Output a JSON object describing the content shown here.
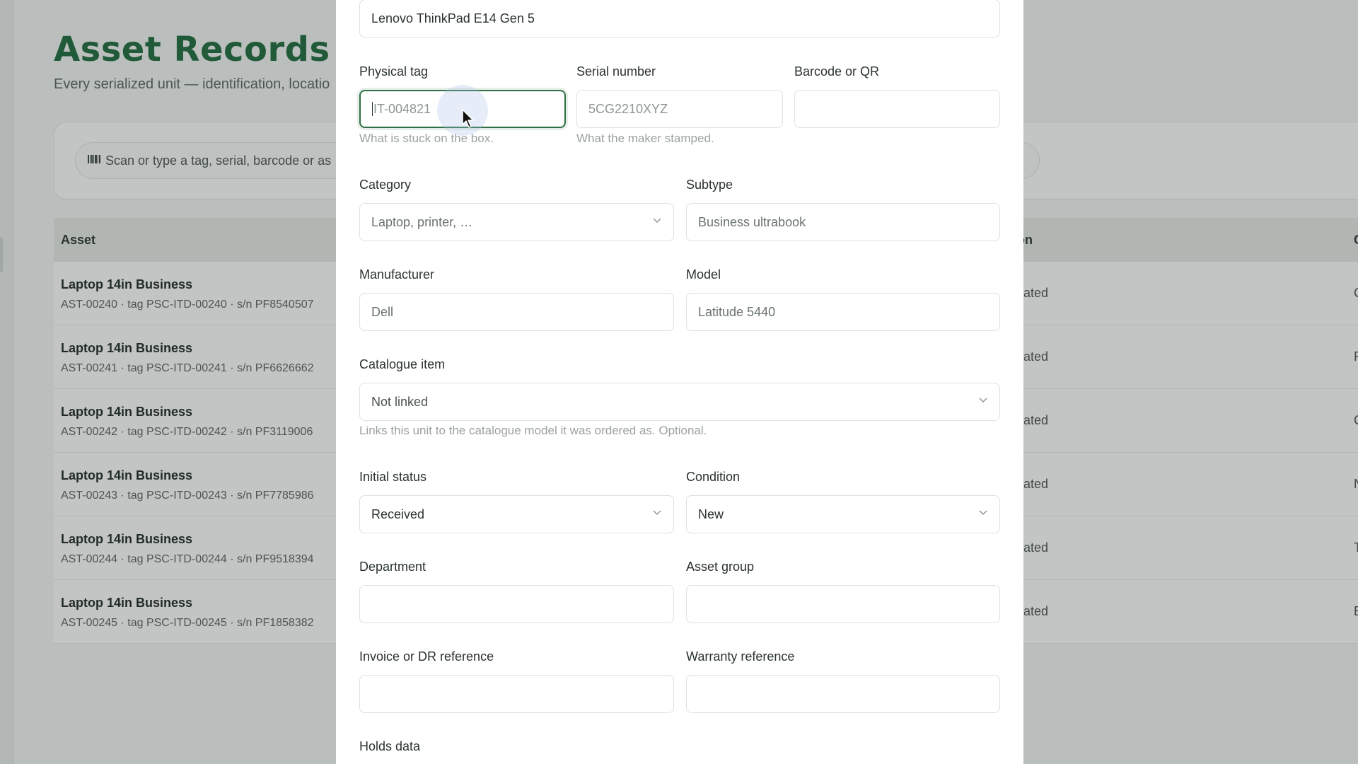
{
  "page": {
    "title": "Asset Records",
    "subtitle": "Every serialized unit — identification, locatio",
    "search_placeholder": "Scan or type a tag, serial, barcode or as",
    "search_icon": "barcode-icon",
    "columns": {
      "asset": "Asset",
      "location": "on",
      "condition": "C"
    },
    "rows": [
      {
        "name": "Laptop 14in Business",
        "meta": "AST-00240 · tag PSC-ITD-00240 · s/n PF8540507",
        "location": "cated",
        "condition": "C"
      },
      {
        "name": "Laptop 14in Business",
        "meta": "AST-00241 · tag PSC-ITD-00241 · s/n PF6626662",
        "location": "cated",
        "condition": "F"
      },
      {
        "name": "Laptop 14in Business",
        "meta": "AST-00242 · tag PSC-ITD-00242 · s/n PF3119006",
        "location": "cated",
        "condition": "C"
      },
      {
        "name": "Laptop 14in Business",
        "meta": "AST-00243 · tag PSC-ITD-00243 · s/n PF7785986",
        "location": "cated",
        "condition": "N"
      },
      {
        "name": "Laptop 14in Business",
        "meta": "AST-00244 · tag PSC-ITD-00244 · s/n PF9518394",
        "location": "cated",
        "condition": "T"
      },
      {
        "name": "Laptop 14in Business",
        "meta": "AST-00245 · tag PSC-ITD-00245 · s/n PF1858382",
        "location": "cated",
        "condition": "E"
      }
    ]
  },
  "modal": {
    "name_value": "Lenovo ThinkPad E14 Gen 5",
    "physical_tag": {
      "label": "Physical tag",
      "placeholder": "IT-004821",
      "help": "What is stuck on the box."
    },
    "serial_number": {
      "label": "Serial number",
      "placeholder": "5CG2210XYZ",
      "help": "What the maker stamped."
    },
    "barcode": {
      "label": "Barcode or QR",
      "value": ""
    },
    "category": {
      "label": "Category",
      "placeholder": "Laptop, printer, …"
    },
    "subtype": {
      "label": "Subtype",
      "placeholder": "Business ultrabook"
    },
    "manufacturer": {
      "label": "Manufacturer",
      "placeholder": "Dell"
    },
    "model": {
      "label": "Model",
      "placeholder": "Latitude 5440"
    },
    "catalogue_item": {
      "label": "Catalogue item",
      "value": "Not linked",
      "help": "Links this unit to the catalogue model it was ordered as. Optional."
    },
    "initial_status": {
      "label": "Initial status",
      "value": "Received"
    },
    "condition": {
      "label": "Condition",
      "value": "New"
    },
    "department": {
      "label": "Department",
      "value": ""
    },
    "asset_group": {
      "label": "Asset group",
      "value": ""
    },
    "invoice_ref": {
      "label": "Invoice or DR reference",
      "value": ""
    },
    "warranty_ref": {
      "label": "Warranty reference",
      "value": ""
    },
    "holds_data": {
      "label": "Holds data"
    }
  },
  "colors": {
    "brand": "#1f6b3f",
    "focus": "#2f6f45"
  }
}
